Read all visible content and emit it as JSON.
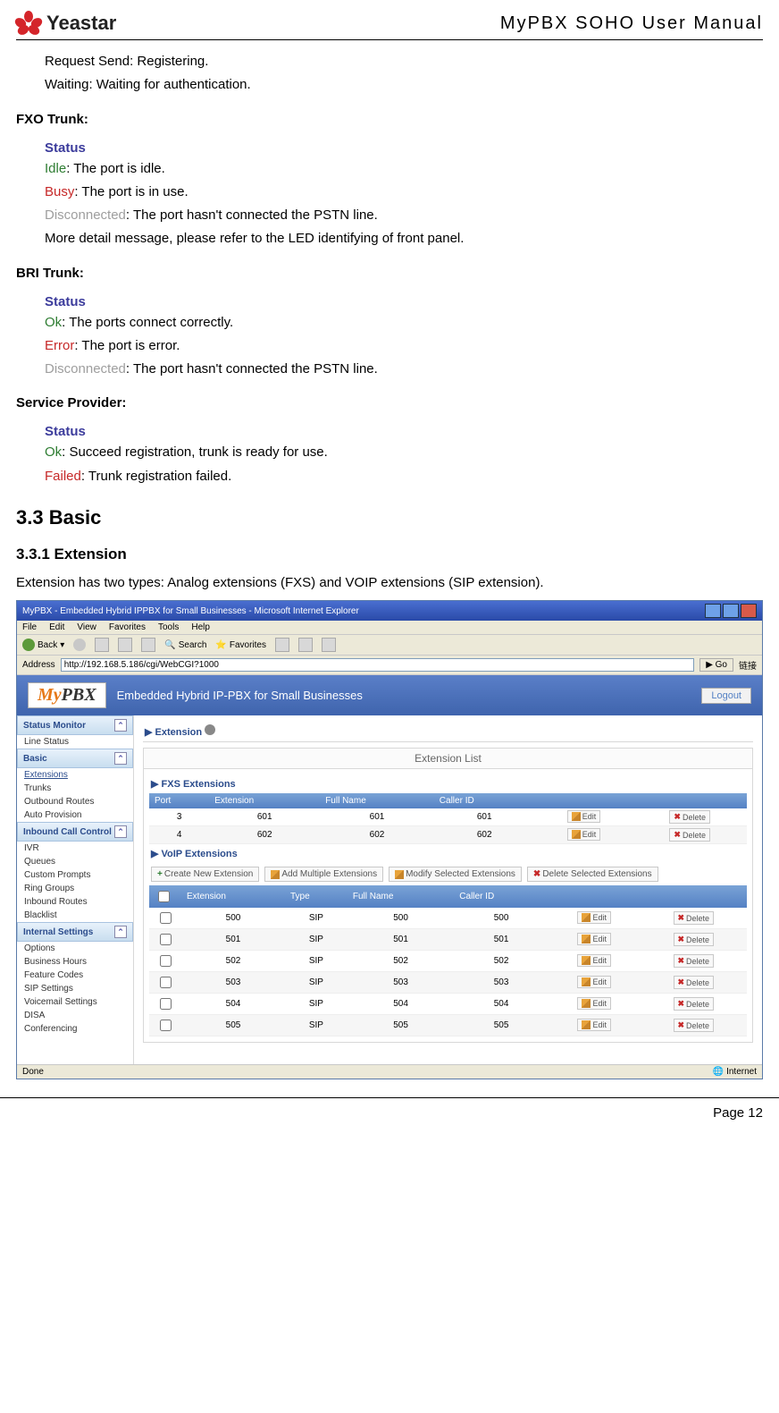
{
  "header": {
    "brand": "Yeastar",
    "doc_title": "MyPBX SOHO User Manual"
  },
  "intro": {
    "line1": "Request Send: Registering.",
    "line2": "Waiting: Waiting for authentication."
  },
  "fxo": {
    "title": "FXO Trunk",
    "status_label": "Status",
    "idle_label": "Idle",
    "idle_desc": ": The port is idle.",
    "busy_label": "Busy",
    "busy_desc": ": The port is in use.",
    "disc_label": "Disconnected",
    "disc_desc": ": The port hasn't connected the PSTN line.",
    "more": "More detail message, please refer to the LED identifying of front panel."
  },
  "bri": {
    "title": "BRI Trunk",
    "status_label": "Status",
    "ok_label": "Ok",
    "ok_desc": ": The ports connect correctly.",
    "error_label": "Error",
    "error_desc": ": The port is error.",
    "disc_label": "Disconnected",
    "disc_desc": ": The port hasn't connected the PSTN line."
  },
  "sp": {
    "title": "Service Provider",
    "status_label": "Status",
    "ok_label": "Ok",
    "ok_desc": ": Succeed registration, trunk is ready for use.",
    "failed_label": "Failed",
    "failed_desc": ": Trunk registration failed."
  },
  "h2": "3.3 Basic",
  "h3": "3.3.1 Extension",
  "ext_para": "Extension has two types: Analog extensions (FXS) and VOIP extensions (SIP extension).",
  "browser": {
    "title": "MyPBX - Embedded Hybrid IPPBX for Small Businesses - Microsoft Internet Explorer",
    "menus": [
      "File",
      "Edit",
      "View",
      "Favorites",
      "Tools",
      "Help"
    ],
    "back": "Back",
    "search": "Search",
    "favorites": "Favorites",
    "addr_label": "Address",
    "url": "http://192.168.5.186/cgi/WebCGI?1000",
    "go": "Go",
    "links": "链接",
    "app_tagline": "Embedded Hybrid IP-PBX for Small Businesses",
    "logout": "Logout",
    "sidebar": {
      "s1": "Status Monitor",
      "s1_items": [
        "Line Status"
      ],
      "s2": "Basic",
      "s2_items": [
        "Extensions",
        "Trunks",
        "Outbound Routes",
        "Auto Provision"
      ],
      "s3": "Inbound Call Control",
      "s3_items": [
        "IVR",
        "Queues",
        "Custom Prompts",
        "Ring Groups",
        "Inbound Routes",
        "Blacklist"
      ],
      "s4": "Internal Settings",
      "s4_items": [
        "Options",
        "Business Hours",
        "Feature Codes",
        "SIP Settings",
        "Voicemail Settings",
        "DISA",
        "Conferencing"
      ]
    },
    "breadcrumb_label": "Extension",
    "panel_title": "Extension List",
    "fxs_head": "FXS Extensions",
    "voip_head": "VoIP Extensions",
    "cols_fxs": [
      "Port",
      "Extension",
      "Full Name",
      "Caller ID"
    ],
    "cols_voip": [
      "",
      "Extension",
      "Type",
      "Full Name",
      "Caller ID"
    ],
    "fxs_rows": [
      {
        "port": "3",
        "ext": "601",
        "name": "601",
        "cid": "601"
      },
      {
        "port": "4",
        "ext": "602",
        "name": "602",
        "cid": "602"
      }
    ],
    "voip_rows": [
      {
        "ext": "500",
        "type": "SIP",
        "name": "500",
        "cid": "500"
      },
      {
        "ext": "501",
        "type": "SIP",
        "name": "501",
        "cid": "501"
      },
      {
        "ext": "502",
        "type": "SIP",
        "name": "502",
        "cid": "502"
      },
      {
        "ext": "503",
        "type": "SIP",
        "name": "503",
        "cid": "503"
      },
      {
        "ext": "504",
        "type": "SIP",
        "name": "504",
        "cid": "504"
      },
      {
        "ext": "505",
        "type": "SIP",
        "name": "505",
        "cid": "505"
      }
    ],
    "buttons": {
      "create": "Create New Extension",
      "add_multi": "Add Multiple Extensions",
      "modify_sel": "Modify Selected Extensions",
      "delete_sel": "Delete Selected Extensions",
      "edit": "Edit",
      "delete": "Delete"
    },
    "status_done": "Done",
    "status_zone": "Internet"
  },
  "footer": "Page 12"
}
